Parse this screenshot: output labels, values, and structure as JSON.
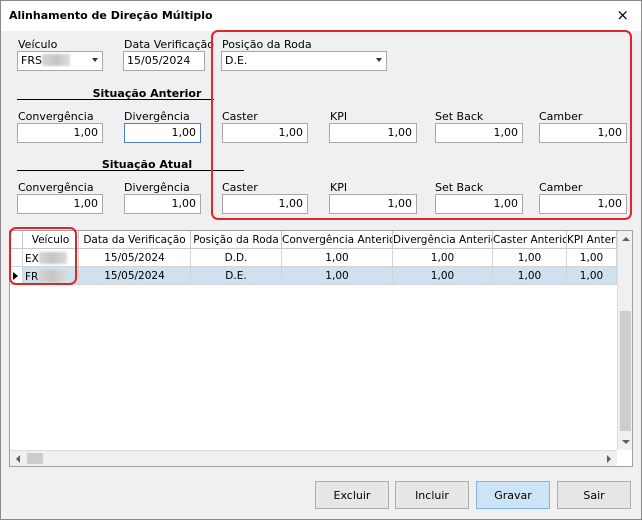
{
  "window": {
    "title": "Alinhamento de Direção Múltiplo",
    "close_glyph": "×"
  },
  "form": {
    "veiculo_label": "Veículo",
    "veiculo_value": "FRS",
    "data_label": "Data Verificação",
    "data_value": "15/05/2024",
    "posicao_label": "Posição da Roda",
    "posicao_value": "D.E."
  },
  "anterior": {
    "title": "Situação Anterior",
    "fields": [
      {
        "label": "Convergência",
        "value": "1,00"
      },
      {
        "label": "Divergência",
        "value": "1,00"
      },
      {
        "label": "Caster",
        "value": "1,00"
      },
      {
        "label": "KPI",
        "value": "1,00"
      },
      {
        "label": "Set Back",
        "value": "1,00"
      },
      {
        "label": "Camber",
        "value": "1,00"
      }
    ]
  },
  "atual": {
    "title": "Situação Atual",
    "fields": [
      {
        "label": "Convergência",
        "value": "1,00"
      },
      {
        "label": "Divergência",
        "value": "1,00"
      },
      {
        "label": "Caster",
        "value": "1,00"
      },
      {
        "label": "KPI",
        "value": "1,00"
      },
      {
        "label": "Set Back",
        "value": "1,00"
      },
      {
        "label": "Camber",
        "value": "1,00"
      }
    ]
  },
  "grid": {
    "columns": [
      "Veículo",
      "Data da Verificação",
      "Posição da Roda",
      "Convergência Anterior",
      "Divergência Anterior",
      "Caster Anterior",
      "KPI Anterior"
    ],
    "rows": [
      [
        "EX",
        "15/05/2024",
        "D.D.",
        "1,00",
        "1,00",
        "1,00",
        "1,00"
      ],
      [
        "FR",
        "15/05/2024",
        "D.E.",
        "1,00",
        "1,00",
        "1,00",
        "1,00"
      ]
    ]
  },
  "buttons": {
    "excluir": "Excluir",
    "incluir": "Incluir",
    "gravar": "Gravar",
    "sair": "Sair"
  },
  "colors": {
    "highlight": "#e0262a",
    "selected_row": "#cfe0ef",
    "default_button": "#cde3f6"
  }
}
